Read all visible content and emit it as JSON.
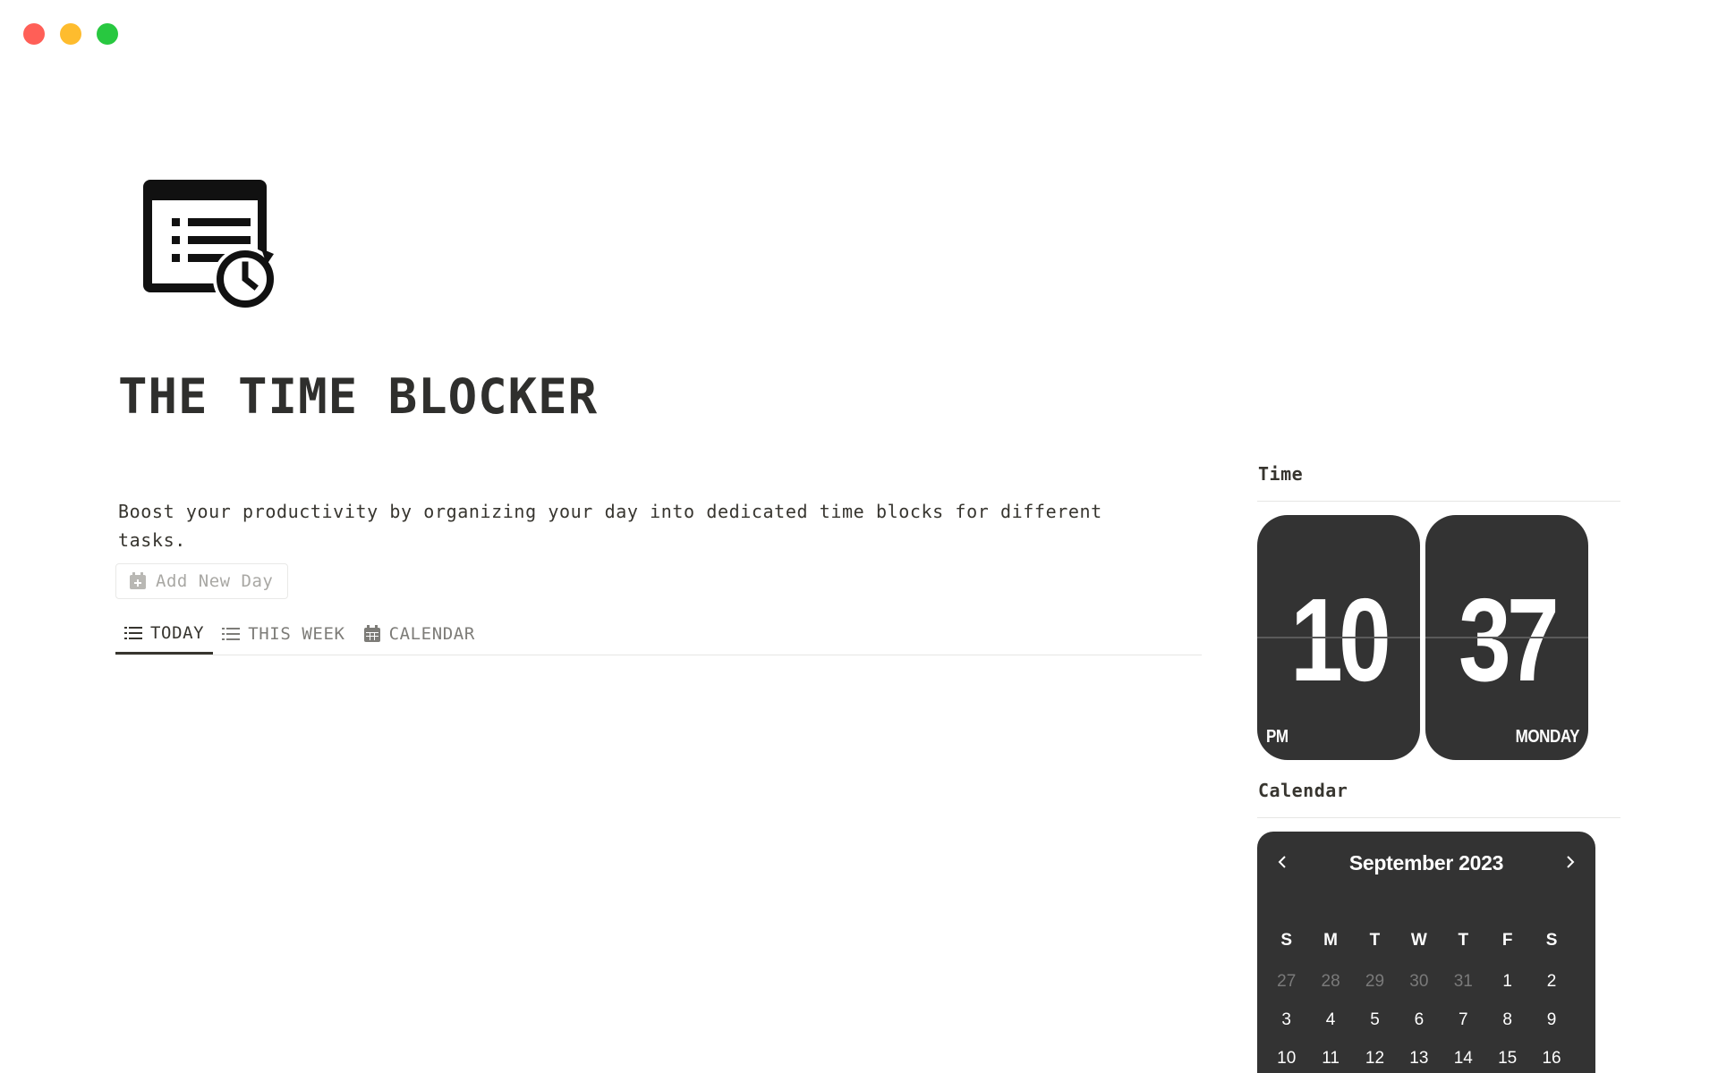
{
  "window": {
    "controls": [
      "close",
      "minimize",
      "zoom"
    ]
  },
  "page": {
    "icon": "time-blocker-icon",
    "title": "THE TIME BLOCKER",
    "description": "Boost your productivity by organizing your day into dedicated time blocks for different tasks."
  },
  "add_button": {
    "label": "Add New Day",
    "icon": "calendar-add-icon"
  },
  "tabs": [
    {
      "label": "TODAY",
      "icon": "list-icon",
      "active": true
    },
    {
      "label": "THIS WEEK",
      "icon": "list-icon",
      "active": false
    },
    {
      "label": "CALENDAR",
      "icon": "calendar-grid-icon",
      "active": false
    }
  ],
  "sidebar": {
    "time_heading": "Time",
    "calendar_heading": "Calendar",
    "clock": {
      "hour": "10",
      "minute": "37",
      "meridiem": "PM",
      "weekday": "MONDAY"
    },
    "calendar": {
      "month_label": "September 2023",
      "weekdays": [
        "S",
        "M",
        "T",
        "W",
        "T",
        "F",
        "S"
      ],
      "weeks": [
        [
          {
            "d": "27",
            "muted": true
          },
          {
            "d": "28",
            "muted": true
          },
          {
            "d": "29",
            "muted": true
          },
          {
            "d": "30",
            "muted": true
          },
          {
            "d": "31",
            "muted": true
          },
          {
            "d": "1",
            "muted": false
          },
          {
            "d": "2",
            "muted": false
          }
        ],
        [
          {
            "d": "3",
            "muted": false
          },
          {
            "d": "4",
            "muted": false
          },
          {
            "d": "5",
            "muted": false
          },
          {
            "d": "6",
            "muted": false
          },
          {
            "d": "7",
            "muted": false
          },
          {
            "d": "8",
            "muted": false
          },
          {
            "d": "9",
            "muted": false
          }
        ],
        [
          {
            "d": "10",
            "muted": false
          },
          {
            "d": "11",
            "muted": false
          },
          {
            "d": "12",
            "muted": false
          },
          {
            "d": "13",
            "muted": false
          },
          {
            "d": "14",
            "muted": false
          },
          {
            "d": "15",
            "muted": false
          },
          {
            "d": "16",
            "muted": false
          }
        ]
      ]
    }
  },
  "colors": {
    "text": "#37352f",
    "widget_bg": "#333333",
    "muted": "#7d7c78"
  }
}
